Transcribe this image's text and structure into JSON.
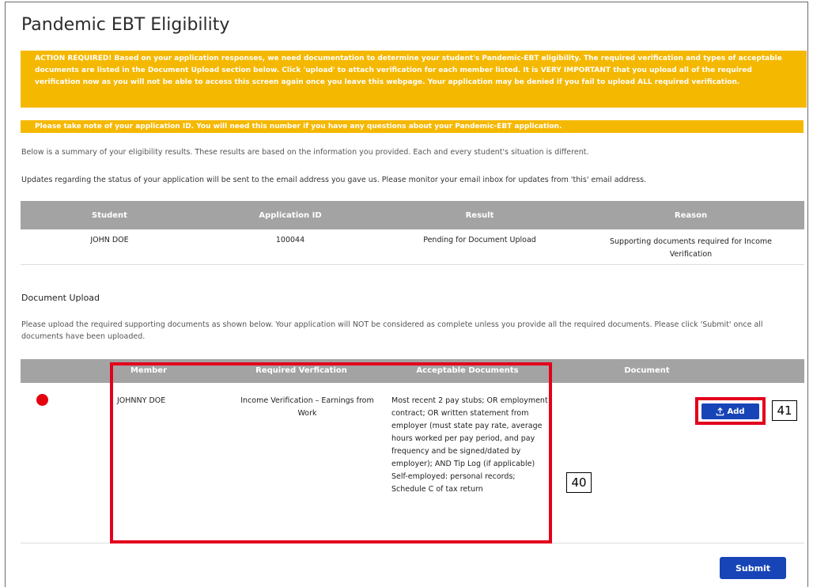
{
  "page": {
    "title": "Pandemic EBT Eligibility",
    "banner_action": "ACTION REQUIRED! Based on your application responses, we need documentation to determine your student's Pandemic-EBT eligibility. The required verification and types of acceptable documents are listed in the Document Upload section below. Click 'upload' to attach verification for each member listed. It is VERY IMPORTANT that you upload all of the required verification now as you will not be able to access this screen again once you leave this webpage. Your application may be denied if you fail to upload ALL required verification.",
    "banner_note": "Please take note of your application ID. You will need this number if you have any questions about your Pandemic-EBT application.",
    "summary_text": "Below is a summary of your eligibility results. These results are based on the information you provided. Each and every student's situation is different.",
    "updates_text": "Updates regarding the status of your application will be sent to the email address you gave us. Please monitor your email inbox for updates from 'this' email address."
  },
  "results_table": {
    "headers": [
      "Student",
      "Application ID",
      "Result",
      "Reason"
    ],
    "rows": [
      [
        "JOHN DOE",
        "100044",
        "Pending for Document Upload",
        "Supporting documents required for Income Verification"
      ]
    ]
  },
  "document_upload": {
    "title": "Document Upload",
    "instructions": "Please upload the required supporting documents as shown below. Your application will NOT be considered as complete unless you provide all the required documents. Please click 'Submit' once all documents have been uploaded.",
    "headers": [
      "Member",
      "Required Verfication",
      "Acceptable Documents",
      "Document"
    ],
    "rows": [
      {
        "status": "missing",
        "member": "JOHNNY DOE",
        "verification": "Income Verification – Earnings from Work",
        "documents": "Most recent 2 pay stubs; OR employment contract; OR written statement from employer (must state pay rate, average hours worked per pay period, and pay frequency and be signed/dated by employer); AND Tip Log (if applicable) Self-employed: personal records; Schedule C of tax return",
        "add_label": "Add",
        "add_icon": "upload-icon"
      }
    ]
  },
  "annotations": {
    "region_40": "40",
    "button_41": "41"
  },
  "submit_label": "Submit",
  "colors": {
    "banner": "#f5b800",
    "header_gray": "#a3a3a3",
    "button_blue": "#1745b8",
    "highlight_red": "#e3001b",
    "status_red": "#e3000f"
  }
}
